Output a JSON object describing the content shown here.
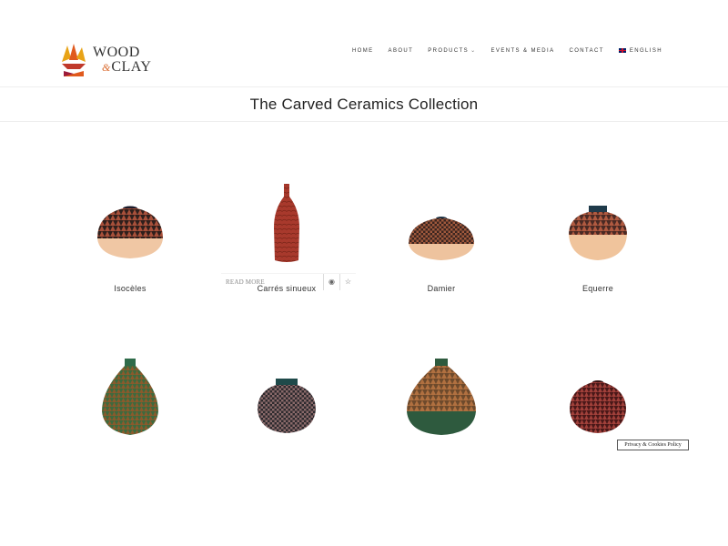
{
  "brand": {
    "line1": "WOOD",
    "amp": "&",
    "line2": "CLAY"
  },
  "nav": {
    "items": [
      {
        "label": "HOME",
        "has_dropdown": false
      },
      {
        "label": "ABOUT",
        "has_dropdown": false
      },
      {
        "label": "PRODUCTS",
        "has_dropdown": true
      },
      {
        "label": "EVENTS & MEDIA",
        "has_dropdown": false
      },
      {
        "label": "CONTACT",
        "has_dropdown": false
      },
      {
        "label": "ENGLISH",
        "has_dropdown": false,
        "icon": "uk-flag-icon"
      }
    ]
  },
  "page": {
    "title": "The Carved Ceramics Collection"
  },
  "products": [
    {
      "name": "Isocèles",
      "shape": "round-squat",
      "color": "#2f1f1c",
      "base": "#f0c7a4",
      "pattern": "diamond"
    },
    {
      "name": "Carrés sinueux",
      "shape": "bottle",
      "color": "#a8392c",
      "base": "#a8392c",
      "pattern": "wave"
    },
    {
      "name": "Damier",
      "shape": "flat",
      "color": "#3a2520",
      "base": "#eec39e",
      "pattern": "checker"
    },
    {
      "name": "Equerre",
      "shape": "round-tall",
      "color": "#4a2a24",
      "base": "#f0c49c",
      "pattern": "diamond"
    },
    {
      "name": "",
      "shape": "teardrop",
      "color": "#6b5a2c",
      "base": "#2f6b4a",
      "pattern": "diamond"
    },
    {
      "name": "",
      "shape": "round-squat",
      "color": "#4a3a3a",
      "base": "#2d2a2e",
      "pattern": "checker"
    },
    {
      "name": "",
      "shape": "teardrop-wide",
      "color": "#6e4a2c",
      "base": "#2e5a3e",
      "pattern": "diamond"
    },
    {
      "name": "",
      "shape": "round-squat",
      "color": "#7a2a2a",
      "base": "#4a1818",
      "pattern": "diamond"
    }
  ],
  "hover": {
    "read_more": "READ MORE",
    "icons": [
      "eye-icon",
      "star-icon"
    ]
  },
  "cookie": {
    "label": "Privacy & Cookies Policy"
  }
}
